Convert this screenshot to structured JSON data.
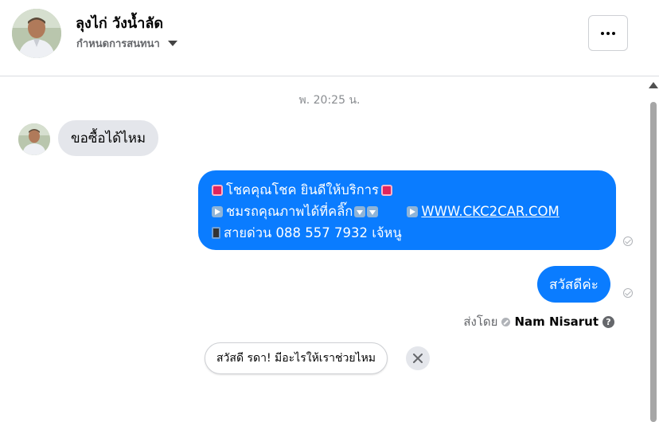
{
  "header": {
    "contact_name": "ลุงไก่ วังน้ำลัด",
    "settings_label": "กำหนดการสนทนา",
    "more_icon": "more-horizontal-icon"
  },
  "conversation": {
    "timestamp": "พ. 20:25 น.",
    "incoming": [
      {
        "text": "ขอซื้อได้ไหม"
      }
    ],
    "outgoing_promo": {
      "line1": "โชคคุณโชค ยินดีให้บริการ",
      "line2": "ชมรถคุณภาพได้ที่คลิ๊ก",
      "link": "WWW.CKC2CAR.COM",
      "line3": "สายด่วน 088 557 7932 เจ้หนู"
    },
    "outgoing_greeting": "สวัสดีค่ะ",
    "sent_by_label": "ส่งโดย",
    "sender_name": "Nam Nisarut"
  },
  "quick_reply": {
    "text": "สวัสดี รดา! มีอะไรให้เราช่วยไหม"
  },
  "colors": {
    "outgoing_bubble": "#0a7cff",
    "incoming_bubble": "#e4e6eb",
    "secondary_text": "#65676b"
  }
}
